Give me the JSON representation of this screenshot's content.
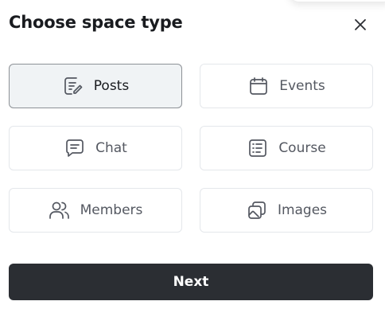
{
  "dialog": {
    "title": "Choose space type",
    "close_icon": "close-icon"
  },
  "options": [
    {
      "label": "Posts",
      "icon": "posts-icon",
      "selected": true
    },
    {
      "label": "Events",
      "icon": "calendar-icon",
      "selected": false
    },
    {
      "label": "Chat",
      "icon": "chat-icon",
      "selected": false
    },
    {
      "label": "Course",
      "icon": "course-icon",
      "selected": false
    },
    {
      "label": "Members",
      "icon": "members-icon",
      "selected": false
    },
    {
      "label": "Images",
      "icon": "images-icon",
      "selected": false
    }
  ],
  "footer": {
    "next_label": "Next"
  },
  "colors": {
    "selected_bg": "#f0f3f5",
    "selected_border": "#8d9196",
    "button_bg": "#2b2e33",
    "icon_color": "#545861"
  }
}
